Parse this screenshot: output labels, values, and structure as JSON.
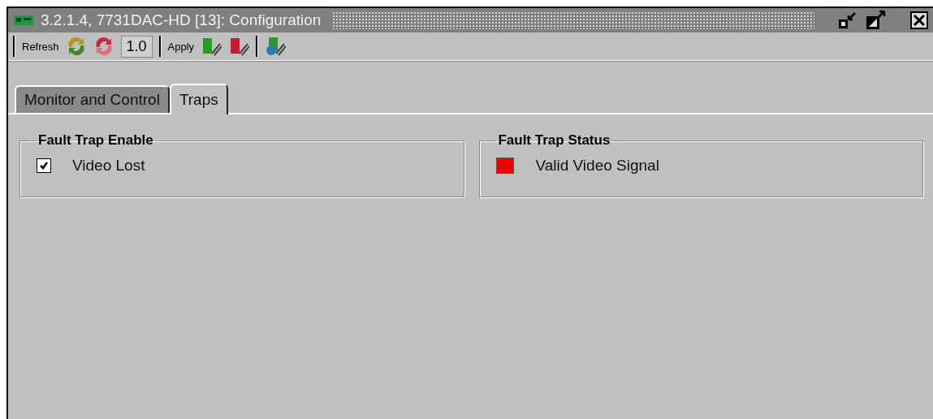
{
  "window": {
    "title": "3.2.1.4, 7731DAC-HD  [13]: Configuration"
  },
  "toolbar": {
    "refresh_label": "Refresh",
    "version": "1.0",
    "apply_label": "Apply"
  },
  "tabs": [
    {
      "label": "Monitor and Control",
      "selected": false
    },
    {
      "label": "Traps",
      "selected": true
    }
  ],
  "fault_trap_enable": {
    "title": "Fault Trap Enable",
    "items": [
      {
        "label": "Video Lost",
        "checked": true
      }
    ]
  },
  "fault_trap_status": {
    "title": "Fault Trap Status",
    "items": [
      {
        "label": "Valid Video Signal",
        "color": "#ee0000"
      }
    ]
  }
}
